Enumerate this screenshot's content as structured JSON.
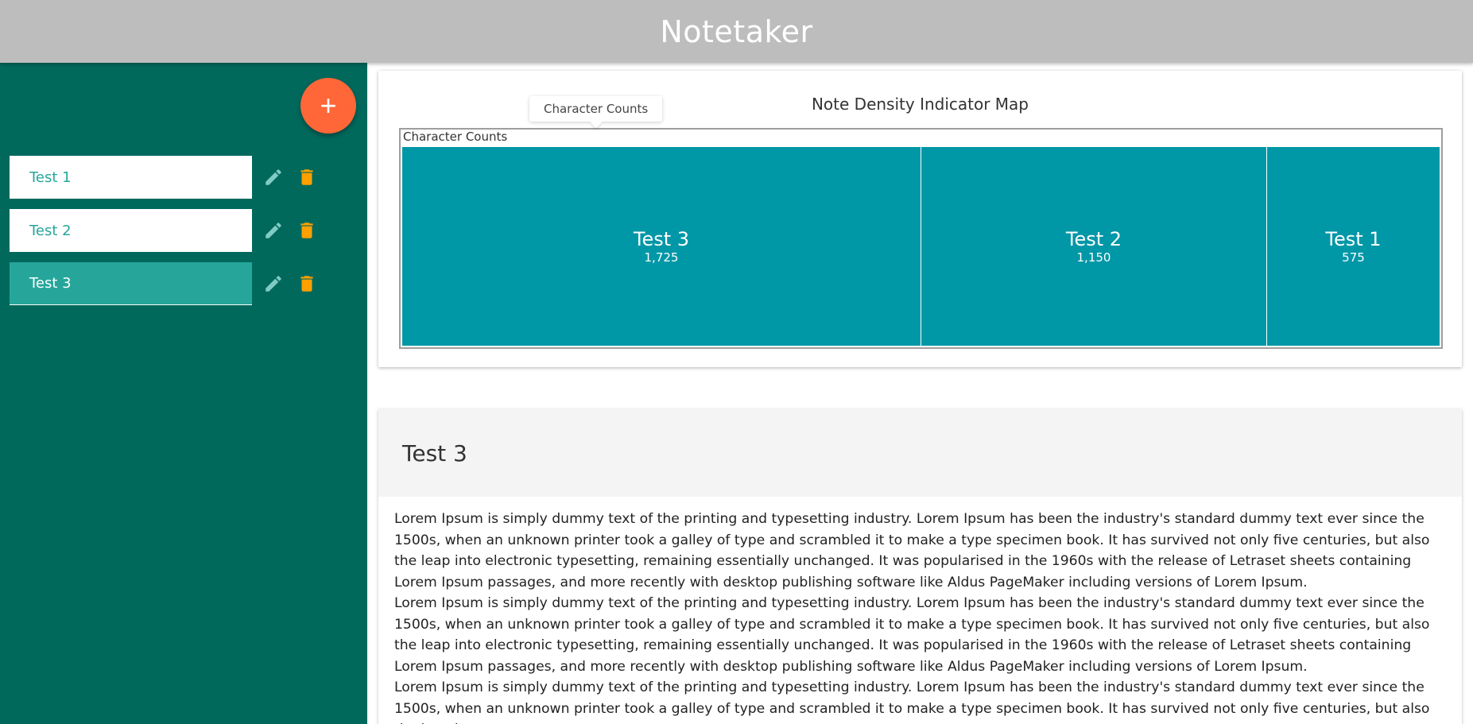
{
  "app": {
    "title": "Notetaker"
  },
  "sidebar": {
    "add_button_label": "+",
    "notes": [
      {
        "title": "Test 1",
        "active": false
      },
      {
        "title": "Test 2",
        "active": false
      },
      {
        "title": "Test 3",
        "active": true
      }
    ],
    "icons": {
      "edit": "pencil-icon",
      "delete": "trash-icon"
    },
    "colors": {
      "background": "#00695c",
      "item_text": "#26a69a",
      "active_item": "#26a69a",
      "edit_icon": "#80cbc4",
      "delete_icon": "#ffa000",
      "fab": "#ff6638"
    }
  },
  "chart": {
    "title": "Note Density Indicator Map",
    "tooltip": "Character Counts",
    "root_label": "Character Counts"
  },
  "chart_data": {
    "type": "treemap",
    "title": "Note Density Indicator Map",
    "root": "Character Counts",
    "categories": [
      "Test 3",
      "Test 2",
      "Test 1"
    ],
    "values": [
      1725,
      1150,
      575
    ],
    "value_labels": [
      "1,725",
      "1,150",
      "575"
    ],
    "color": "#0097a7"
  },
  "note": {
    "title": "Test 3",
    "paragraphs": [
      "Lorem Ipsum is simply dummy text of the printing and typesetting industry. Lorem Ipsum has been the industry's standard dummy text ever since the 1500s, when an unknown printer took a galley of type and scrambled it to make a type specimen book. It has survived not only five centuries, but also the leap into electronic typesetting, remaining essentially unchanged. It was popularised in the 1960s with the release of Letraset sheets containing Lorem Ipsum passages, and more recently with desktop publishing software like Aldus PageMaker including versions of Lorem Ipsum.",
      "Lorem Ipsum is simply dummy text of the printing and typesetting industry. Lorem Ipsum has been the industry's standard dummy text ever since the 1500s, when an unknown printer took a galley of type and scrambled it to make a type specimen book. It has survived not only five centuries, but also the leap into electronic typesetting, remaining essentially unchanged. It was popularised in the 1960s with the release of Letraset sheets containing Lorem Ipsum passages, and more recently with desktop publishing software like Aldus PageMaker including versions of Lorem Ipsum.",
      "Lorem Ipsum is simply dummy text of the printing and typesetting industry. Lorem Ipsum has been the industry's standard dummy text ever since the 1500s, when an unknown printer took a galley of type and scrambled it to make a type specimen book. It has survived not only five centuries, but also the leap into"
    ]
  }
}
